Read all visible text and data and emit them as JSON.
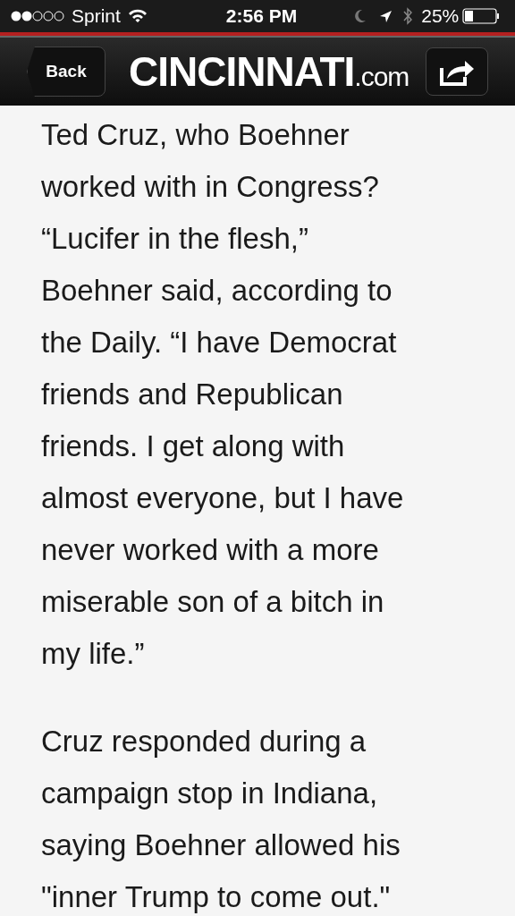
{
  "status_bar": {
    "carrier": "Sprint",
    "time": "2:56 PM",
    "battery": "25%"
  },
  "header": {
    "back": "Back",
    "logo": "CINCINNATI",
    "logo_suffix": ".com"
  },
  "article": {
    "paragraphs": [
      [
        "Ted Cruz, who Boehner",
        "worked with in Congress?",
        "“Lucifer in the flesh,”",
        "Boehner said, according to",
        "the Daily. “I have Democrat",
        "friends and Republican",
        "friends. I get along with",
        "almost everyone, but I have",
        "never worked with a more",
        "miserable son of a bitch in",
        "my life.”"
      ],
      [
        "Cruz responded during a",
        "campaign stop in Indiana,",
        "saying Boehner allowed his",
        "\"inner Trump to come out.\""
      ]
    ]
  }
}
